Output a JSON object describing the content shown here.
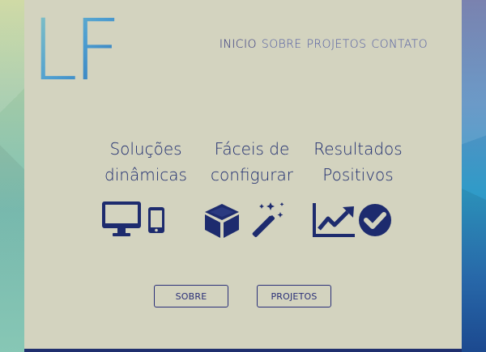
{
  "logo": {
    "text": "LF"
  },
  "nav": {
    "items": [
      {
        "label": "INICIO"
      },
      {
        "label": "SOBRE"
      },
      {
        "label": "PROJETOS"
      },
      {
        "label": "CONTATO"
      }
    ]
  },
  "features": [
    {
      "line1": "Soluções",
      "line2": "dinâmicas",
      "icons": [
        "monitor-icon",
        "smartphone-icon"
      ]
    },
    {
      "line1": "Fáceis de",
      "line2": "configurar",
      "icons": [
        "cube-icon",
        "magic-wand-icon"
      ]
    },
    {
      "line1": "Resultados",
      "line2": "Positivos",
      "icons": [
        "line-chart-icon",
        "check-circle-icon"
      ]
    }
  ],
  "buttons": {
    "sobre": "SOBRE",
    "projetos": "PROJETOS"
  },
  "colors": {
    "panel": "#d3d3bf",
    "accent": "#1d2b6e",
    "nav_active": "#2c2f7a",
    "nav_inactive": "#4f5aa0"
  }
}
